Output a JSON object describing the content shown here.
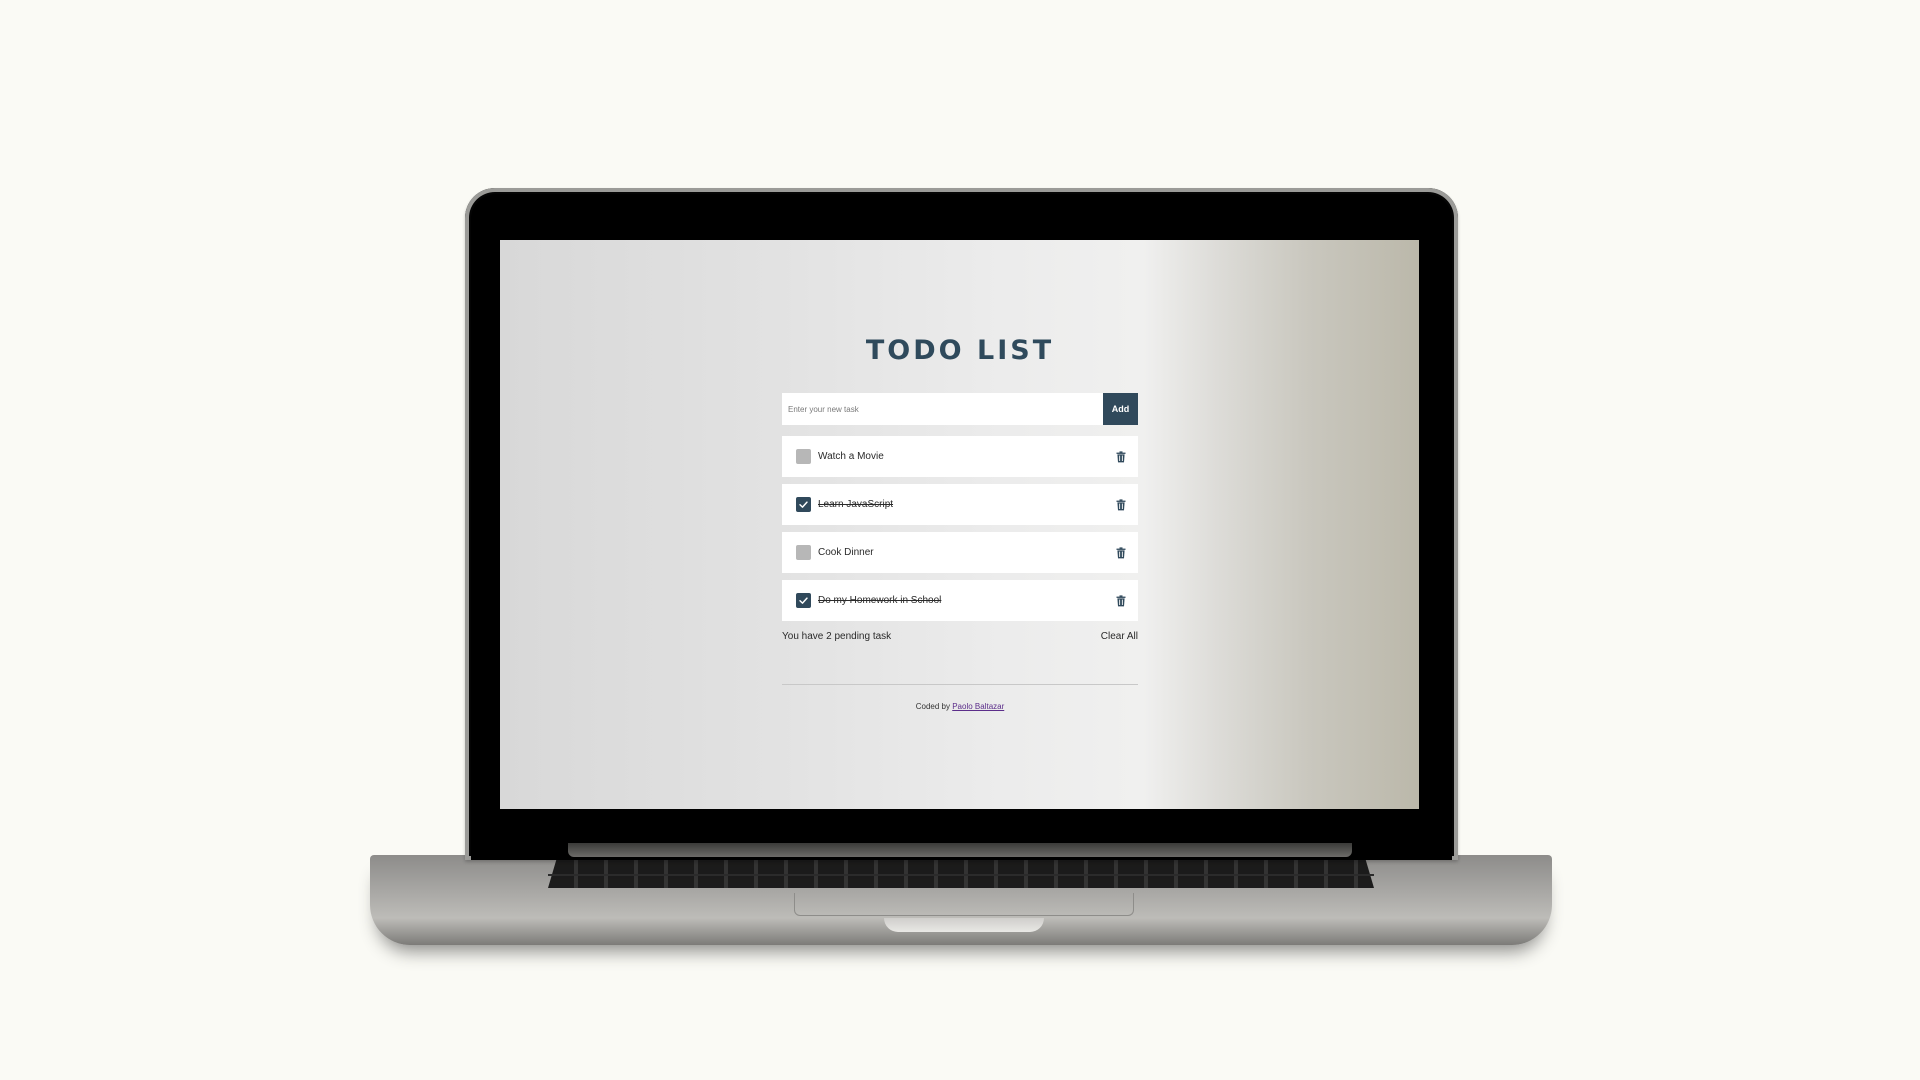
{
  "app": {
    "title": "TODO LIST",
    "input": {
      "placeholder": "Enter your new task",
      "value": ""
    },
    "add_label": "Add",
    "tasks": [
      {
        "label": "Watch a Movie",
        "done": false
      },
      {
        "label": "Learn JavaScript",
        "done": true
      },
      {
        "label": "Cook Dinner",
        "done": false
      },
      {
        "label": "Do my Homework in School",
        "done": true
      }
    ],
    "pending_text": "You have 2 pending task",
    "clear_label": "Clear All",
    "credit_prefix": "Coded by",
    "credit_author": "Paolo Baltazar"
  },
  "colors": {
    "accent": "#30495b",
    "title": "#2f4a5c",
    "unchecked": "#b7b7b7",
    "link": "#5b2d8a"
  },
  "icons": {
    "check": "check-icon",
    "delete": "trash-icon"
  }
}
